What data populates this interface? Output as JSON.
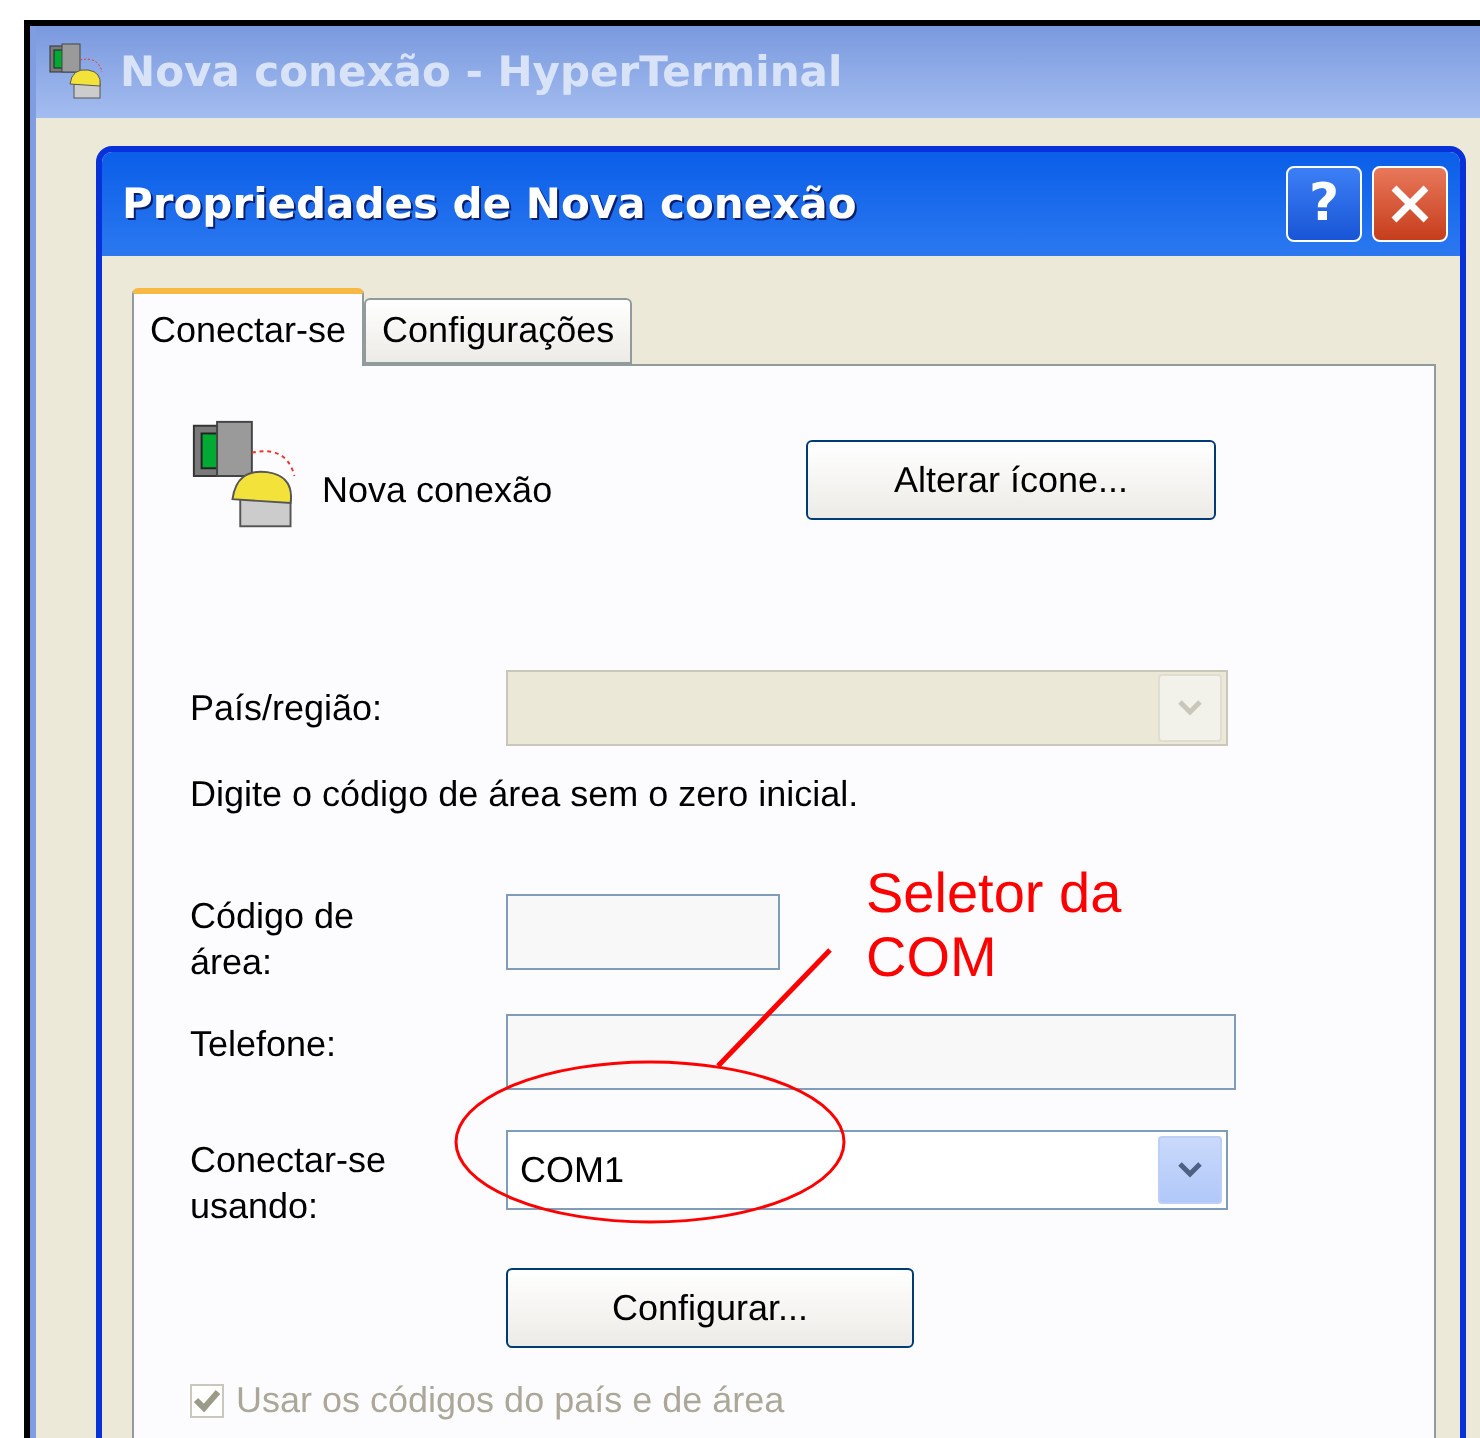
{
  "parent_window": {
    "title": "Nova conexão - HyperTerminal",
    "active": false
  },
  "dialog": {
    "title": "Propriedades de Nova conexão",
    "help_button": "?",
    "active": true
  },
  "tabs": [
    {
      "label": "Conectar-se",
      "selected": true
    },
    {
      "label": "Configurações",
      "selected": false
    }
  ],
  "connection": {
    "name": "Nova conexão",
    "change_icon_button": "Alterar ícone..."
  },
  "fields": [
    {
      "kind": "combo",
      "label": "País/região:",
      "disabled": true
    },
    {
      "kind": "note",
      "text": "Digite o código de área sem o zero inicial."
    },
    {
      "kind": "input_short",
      "label": "Código de área:"
    },
    {
      "kind": "input",
      "label": "Telefone:"
    },
    {
      "kind": "combo",
      "label": "Conectar-se usando:",
      "value": "COM1",
      "disabled": false
    },
    {
      "kind": "button",
      "label": "Configurar..."
    },
    {
      "kind": "checkbox",
      "label": "Usar os códigos do país e de área",
      "checked": true,
      "disabled": true
    }
  ],
  "annotation": {
    "text": "Seletor da COM"
  }
}
